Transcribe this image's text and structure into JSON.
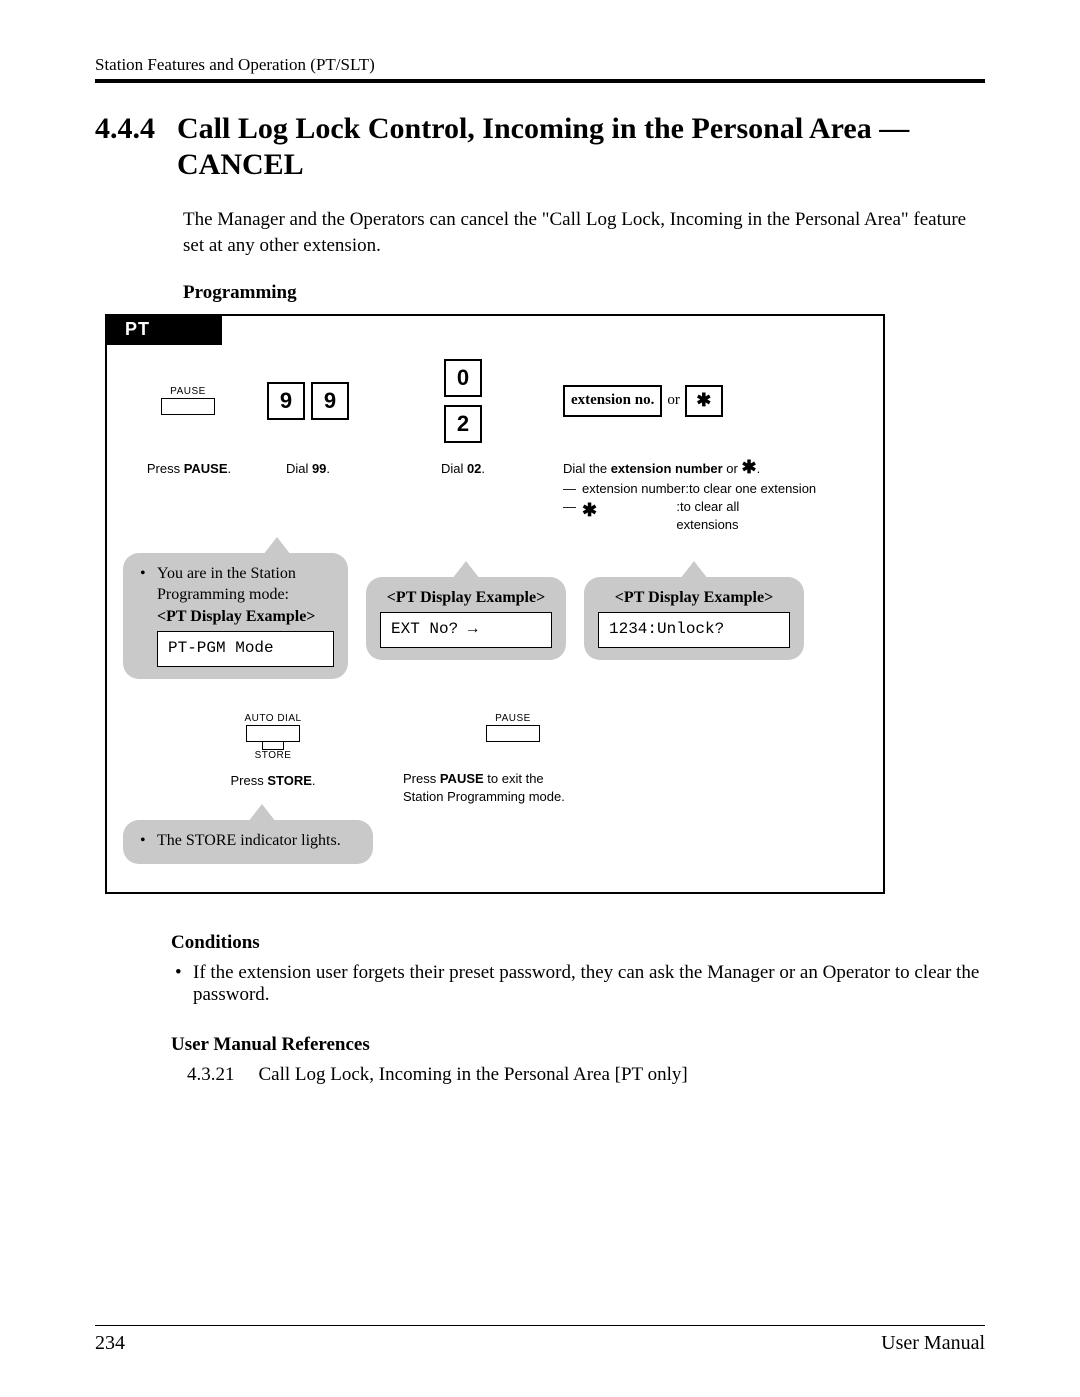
{
  "running_head": "Station Features and Operation (PT/SLT)",
  "section": {
    "number": "4.4.4",
    "title_line1": "Call Log Lock Control, Incoming in the Personal Area —",
    "title_line2": "CANCEL"
  },
  "intro": "The Manager and the Operators can cancel the \"Call Log Lock, Incoming in the Personal Area\" feature set at any other extension.",
  "programming_heading": "Programming",
  "diagram": {
    "tab": "PT",
    "row1": {
      "pause_label": "PAUSE",
      "digits_99": [
        "9",
        "9"
      ],
      "digits_02": [
        "0",
        "2"
      ],
      "ext_btn": "extension no.",
      "or": "or",
      "star": "✱"
    },
    "captions": {
      "press_pause_pre": "Press ",
      "press_pause_bold": "PAUSE",
      "press_pause_post": ".",
      "dial99_pre": "Dial ",
      "dial99_bold": "99",
      "dial99_post": ".",
      "dial02_pre": "Dial ",
      "dial02_bold": "02",
      "dial02_post": ".",
      "dialext_pre": "Dial the ",
      "dialext_bold": "extension number",
      "dialext_mid": " or ",
      "dialext_star": "✱",
      "dialext_post": ".",
      "ext_line1_a": "extension number",
      "ext_line1_b": ":to clear one extension",
      "ext_line2_a": "✱",
      "ext_line2_b": ":to clear all extensions"
    },
    "callout1": {
      "line1": "You are in the Station",
      "line2": "Programming mode:",
      "disp_title": "<PT Display Example>",
      "disp_text": "PT-PGM Mode"
    },
    "callout2": {
      "disp_title": "<PT Display Example>",
      "disp_text": "EXT No? →"
    },
    "callout3": {
      "disp_title": "<PT Display Example>",
      "disp_text": "1234:Unlock?"
    },
    "row2": {
      "autodial_top": "AUTO DIAL",
      "autodial_bottom": "STORE",
      "press_store_pre": "Press ",
      "press_store_bold": "STORE",
      "press_store_post": ".",
      "pause_label": "PAUSE",
      "pause_text_pre": "Press ",
      "pause_text_bold": "PAUSE",
      "pause_text_post": " to exit the",
      "pause_text_line2": "Station Programming mode."
    },
    "callout4": {
      "text": "The STORE indicator lights."
    }
  },
  "conditions_heading": "Conditions",
  "conditions_item": "If the extension user forgets their preset password, they can ask the Manager or an Operator to clear the password.",
  "references_heading": "User Manual References",
  "reference": {
    "num": "4.3.21",
    "text": "Call Log Lock, Incoming in the Personal Area [PT only]"
  },
  "footer": {
    "page": "234",
    "doc": "User Manual"
  }
}
